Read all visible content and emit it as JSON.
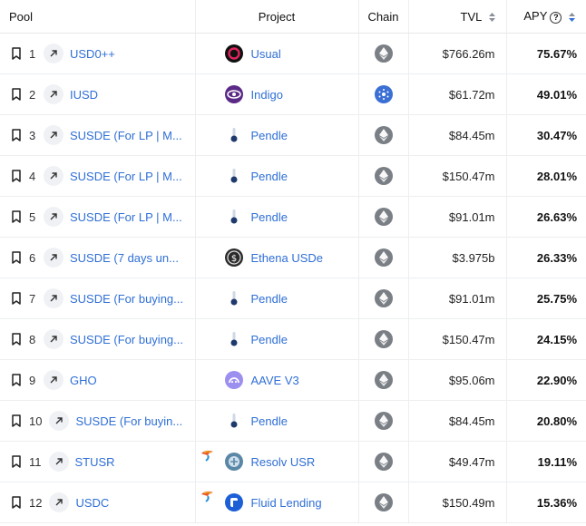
{
  "header": {
    "pool": "Pool",
    "project": "Project",
    "chain": "Chain",
    "tvl": "TVL",
    "apy": "APY",
    "help": "?"
  },
  "rows": [
    {
      "rank": "1",
      "pool": "USD0++",
      "project": "Usual",
      "project_icon": "usual-icon",
      "chain_icon": "ethereum-icon",
      "tvl": "$766.26m",
      "apy": "75.67%"
    },
    {
      "rank": "2",
      "pool": "IUSD",
      "project": "Indigo",
      "project_icon": "indigo-icon",
      "chain_icon": "cardano-icon",
      "tvl": "$61.72m",
      "apy": "49.01%"
    },
    {
      "rank": "3",
      "pool": "SUSDE (For LP | M...",
      "project": "Pendle",
      "project_icon": "pendle-icon",
      "chain_icon": "ethereum-icon",
      "tvl": "$84.45m",
      "apy": "30.47%"
    },
    {
      "rank": "4",
      "pool": "SUSDE (For LP | M...",
      "project": "Pendle",
      "project_icon": "pendle-icon",
      "chain_icon": "ethereum-icon",
      "tvl": "$150.47m",
      "apy": "28.01%"
    },
    {
      "rank": "5",
      "pool": "SUSDE (For LP | M...",
      "project": "Pendle",
      "project_icon": "pendle-icon",
      "chain_icon": "ethereum-icon",
      "tvl": "$91.01m",
      "apy": "26.63%"
    },
    {
      "rank": "6",
      "pool": "SUSDE (7 days un...",
      "project": "Ethena USDe",
      "project_icon": "ethena-icon",
      "chain_icon": "ethereum-icon",
      "tvl": "$3.975b",
      "apy": "26.33%"
    },
    {
      "rank": "7",
      "pool": "SUSDE (For buying...",
      "project": "Pendle",
      "project_icon": "pendle-icon",
      "chain_icon": "ethereum-icon",
      "tvl": "$91.01m",
      "apy": "25.75%"
    },
    {
      "rank": "8",
      "pool": "SUSDE (For buying...",
      "project": "Pendle",
      "project_icon": "pendle-icon",
      "chain_icon": "ethereum-icon",
      "tvl": "$150.47m",
      "apy": "24.15%"
    },
    {
      "rank": "9",
      "pool": "GHO",
      "project": "AAVE V3",
      "project_icon": "aave-icon",
      "chain_icon": "ethereum-icon",
      "tvl": "$95.06m",
      "apy": "22.90%"
    },
    {
      "rank": "10",
      "pool": "SUSDE (For buyin...",
      "project": "Pendle",
      "project_icon": "pendle-icon",
      "chain_icon": "ethereum-icon",
      "tvl": "$84.45m",
      "apy": "20.80%"
    },
    {
      "rank": "11",
      "pool": "STUSR",
      "project": "Resolv USR",
      "project_icon": "resolv-icon",
      "chain_icon": "ethereum-icon",
      "tvl": "$49.47m",
      "apy": "19.11%",
      "parrot": true
    },
    {
      "rank": "12",
      "pool": "USDC",
      "project": "Fluid Lending",
      "project_icon": "fluid-icon",
      "chain_icon": "ethereum-icon",
      "tvl": "$150.49m",
      "apy": "15.36%",
      "parrot": true
    }
  ]
}
